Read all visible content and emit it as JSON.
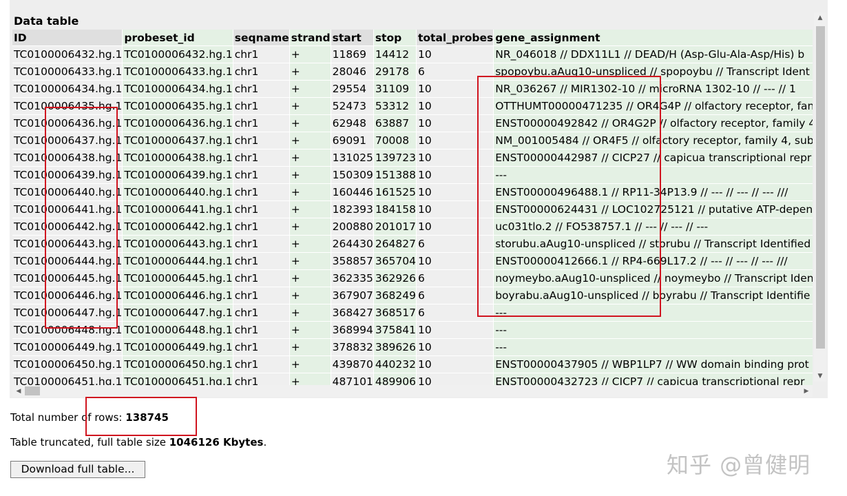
{
  "panel": {
    "title": "Data table"
  },
  "columns": [
    "ID",
    "probeset_id",
    "seqname",
    "strand",
    "start",
    "stop",
    "total_probes",
    "gene_assignment"
  ],
  "rows": [
    [
      "TC0100006432.hg.1",
      "TC0100006432.hg.1",
      "chr1",
      "+",
      "11869",
      "14412",
      "10",
      "NR_046018 // DDX11L1 // DEAD/H (Asp-Glu-Ala-Asp/His) b"
    ],
    [
      "TC0100006433.hg.1",
      "TC0100006433.hg.1",
      "chr1",
      "+",
      "28046",
      "29178",
      "6",
      "spopoybu.aAug10-unspliced // spopoybu // Transcript Ident"
    ],
    [
      "TC0100006434.hg.1",
      "TC0100006434.hg.1",
      "chr1",
      "+",
      "29554",
      "31109",
      "10",
      "NR_036267 // MIR1302-10 // microRNA 1302-10 // --- // 1"
    ],
    [
      "TC0100006435.hg.1",
      "TC0100006435.hg.1",
      "chr1",
      "+",
      "52473",
      "53312",
      "10",
      "OTTHUMT00000471235 // OR4G4P // olfactory receptor, fan"
    ],
    [
      "TC0100006436.hg.1",
      "TC0100006436.hg.1",
      "chr1",
      "+",
      "62948",
      "63887",
      "10",
      "ENST00000492842 // OR4G2P // olfactory receptor, family 4"
    ],
    [
      "TC0100006437.hg.1",
      "TC0100006437.hg.1",
      "chr1",
      "+",
      "69091",
      "70008",
      "10",
      "NM_001005484 // OR4F5 // olfactory receptor, family 4, sub"
    ],
    [
      "TC0100006438.hg.1",
      "TC0100006438.hg.1",
      "chr1",
      "+",
      "131025",
      "139723",
      "10",
      "ENST00000442987 // CICP27 // capicua transcriptional repr"
    ],
    [
      "TC0100006439.hg.1",
      "TC0100006439.hg.1",
      "chr1",
      "+",
      "150309",
      "151388",
      "10",
      "---"
    ],
    [
      "TC0100006440.hg.1",
      "TC0100006440.hg.1",
      "chr1",
      "+",
      "160446",
      "161525",
      "10",
      "ENST00000496488.1 // RP11-34P13.9 // --- // --- // --- ///"
    ],
    [
      "TC0100006441.hg.1",
      "TC0100006441.hg.1",
      "chr1",
      "+",
      "182393",
      "184158",
      "10",
      "ENST00000624431 // LOC102725121 // putative ATP-depen"
    ],
    [
      "TC0100006442.hg.1",
      "TC0100006442.hg.1",
      "chr1",
      "+",
      "200880",
      "201017",
      "10",
      "uc031tlo.2 // FO538757.1 // --- // --- // ---"
    ],
    [
      "TC0100006443.hg.1",
      "TC0100006443.hg.1",
      "chr1",
      "+",
      "264430",
      "264827",
      "6",
      "storubu.aAug10-unspliced // storubu // Transcript Identified"
    ],
    [
      "TC0100006444.hg.1",
      "TC0100006444.hg.1",
      "chr1",
      "+",
      "358857",
      "365704",
      "10",
      "ENST00000412666.1 // RP4-669L17.2 // --- // --- // --- ///"
    ],
    [
      "TC0100006445.hg.1",
      "TC0100006445.hg.1",
      "chr1",
      "+",
      "362335",
      "362926",
      "6",
      "noymeybo.aAug10-unspliced // noymeybo // Transcript Iden"
    ],
    [
      "TC0100006446.hg.1",
      "TC0100006446.hg.1",
      "chr1",
      "+",
      "367907",
      "368249",
      "6",
      "boyrabu.aAug10-unspliced // boyrabu // Transcript Identifie"
    ],
    [
      "TC0100006447.hg.1",
      "TC0100006447.hg.1",
      "chr1",
      "+",
      "368427",
      "368517",
      "6",
      "---"
    ],
    [
      "TC0100006448.hg.1",
      "TC0100006448.hg.1",
      "chr1",
      "+",
      "368994",
      "375841",
      "10",
      "---"
    ],
    [
      "TC0100006449.hg.1",
      "TC0100006449.hg.1",
      "chr1",
      "+",
      "378832",
      "389626",
      "10",
      "---"
    ],
    [
      "TC0100006450.hg.1",
      "TC0100006450.hg.1",
      "chr1",
      "+",
      "439870",
      "440232",
      "10",
      "ENST00000437905 // WBP1LP7 // WW domain binding prot"
    ],
    [
      "TC0100006451.hg.1",
      "TC0100006451.hg.1",
      "chr1",
      "+",
      "487101",
      "489906",
      "10",
      "ENST00000432723 // CICP7 // capicua transcriptional repr"
    ]
  ],
  "info": {
    "rows_label": "Total number of rows:",
    "rows_value": "138745",
    "truncated_label": "Table truncated, full table size",
    "truncated_value": "1046126 Kbytes",
    "truncated_suffix": "."
  },
  "download_label": "Download full table...",
  "watermark": "知乎 @曾健明",
  "colors": {
    "highlight": "#d0141f",
    "green_cell": "#e4f1e4",
    "grey_cell": "#efefef"
  },
  "scroll": {
    "vertical_position": 0,
    "horizontal_position": 0
  }
}
